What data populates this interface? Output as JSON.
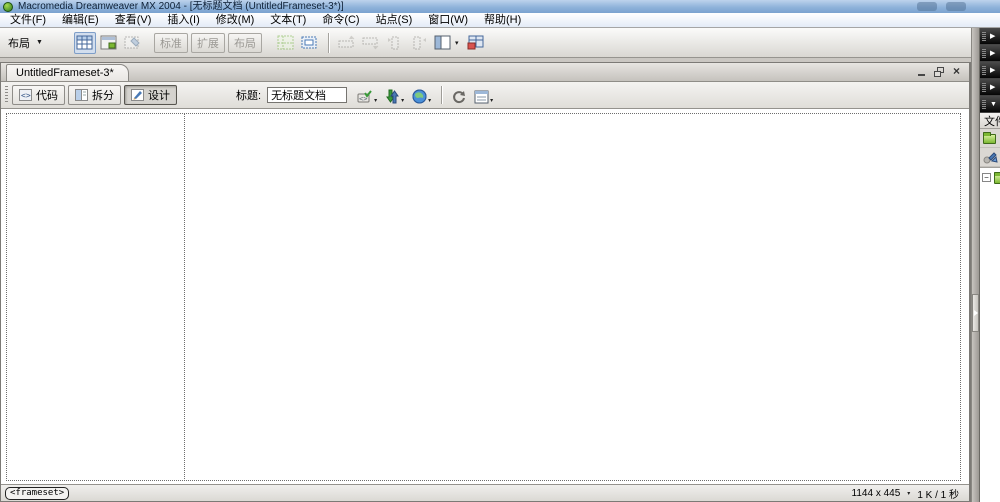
{
  "window": {
    "title": "Macromedia Dreamweaver MX 2004 - [无标题文档 (UntitledFrameset-3*)]"
  },
  "menu_bar": {
    "items": [
      "文件(F)",
      "编辑(E)",
      "查看(V)",
      "插入(I)",
      "修改(M)",
      "文本(T)",
      "命令(C)",
      "站点(S)",
      "窗口(W)",
      "帮助(H)"
    ]
  },
  "insert_bar": {
    "category_label": "布局",
    "mode_buttons": [
      "标准",
      "扩展",
      "布局"
    ],
    "icon_names": [
      "insert-table",
      "insert-div",
      "draw-layer",
      "layout-table",
      "draw-layout-cell",
      "insert-row-above",
      "insert-row-below",
      "insert-column-left",
      "insert-column-right",
      "frames",
      "import-tabular-data"
    ]
  },
  "document": {
    "tab_label": "UntitledFrameset-3*",
    "toolbar": {
      "code": "代码",
      "split": "拆分",
      "design": "设计",
      "title_label": "标题:",
      "title_value": "无标题文档",
      "icon_names": [
        "browser-check",
        "file-management",
        "preview-in-browser",
        "refresh",
        "view-options"
      ]
    },
    "status": {
      "tag": "<frameset>",
      "dimensions": "1144 x 445",
      "stats": "1 K / 1 秒"
    }
  },
  "dock": {
    "collapsed_group_count": 4,
    "files_tab_label": "文件",
    "icon_names": [
      "site-folder",
      "connect-to-remote",
      "site-root-folder"
    ]
  },
  "icons": {
    "caret_down": "▼",
    "caret_small": "▾",
    "arrow_right": "▶",
    "arrow_down": "▼",
    "close_glyph": "×",
    "expander_minus": "−"
  },
  "colors": {
    "titlebar_blue": "#8fb3da",
    "dock_header_black": "#0a0a0a",
    "folder_green": "#7cb832",
    "canvas_white": "#ffffff"
  }
}
